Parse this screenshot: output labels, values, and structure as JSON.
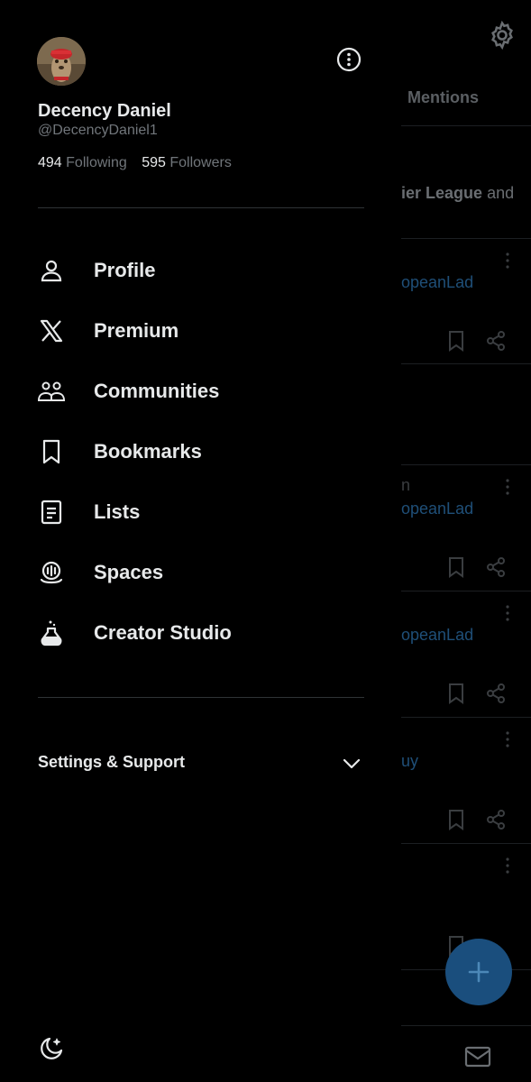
{
  "background": {
    "tab_mentions": "Mentions",
    "fragment_league": "ier League",
    "fragment_and": "and",
    "fragment_handle_a": "opeanLad",
    "fragment_handle_b": "opeanLad",
    "fragment_handle_c": "opeanLad",
    "fragment_n": "n",
    "fragment_uy": "uy"
  },
  "drawer": {
    "user": {
      "name": "Decency Daniel",
      "handle": "@DecencyDaniel1",
      "following_count": "494",
      "following_label": "Following",
      "followers_count": "595",
      "followers_label": "Followers"
    },
    "menu": [
      {
        "label": "Profile",
        "icon": "person-icon"
      },
      {
        "label": "Premium",
        "icon": "x-logo-icon"
      },
      {
        "label": "Communities",
        "icon": "communities-icon"
      },
      {
        "label": "Bookmarks",
        "icon": "bookmark-icon"
      },
      {
        "label": "Lists",
        "icon": "list-icon"
      },
      {
        "label": "Spaces",
        "icon": "spaces-icon"
      },
      {
        "label": "Creator Studio",
        "icon": "flask-icon"
      }
    ],
    "settings_label": "Settings & Support"
  },
  "colors": {
    "background": "#000000",
    "text_primary": "#e7e9ea",
    "text_secondary": "#71767b",
    "divider": "#2f3336",
    "fab": "#1a4e7d"
  }
}
